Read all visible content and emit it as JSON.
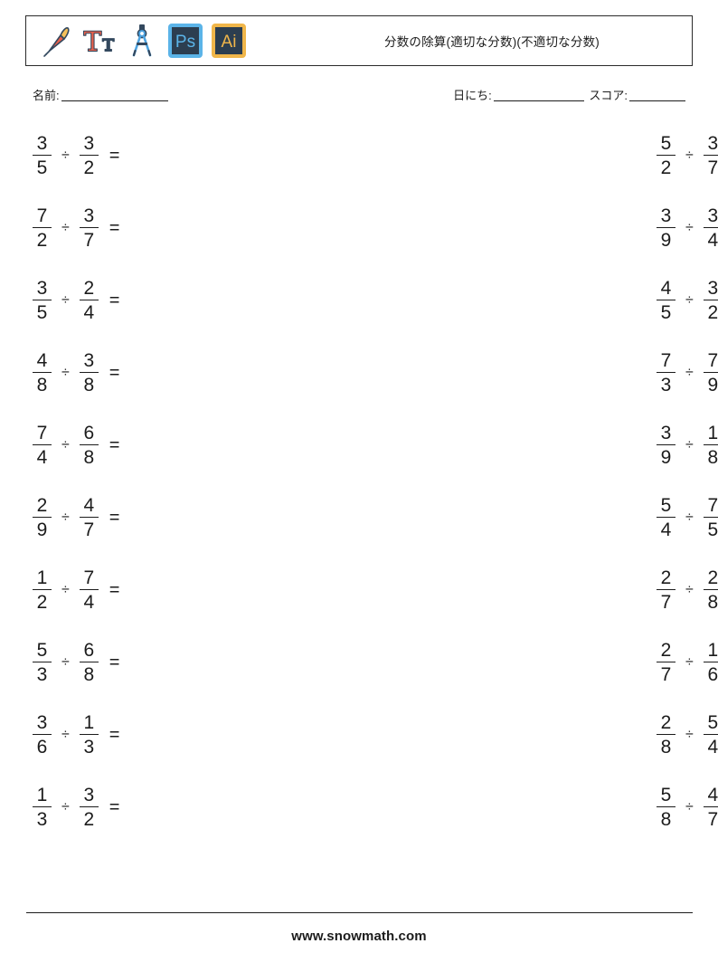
{
  "header": {
    "title": "分数の除算(適切な分数)(不適切な分数)",
    "icons": [
      {
        "name": "paintbrush-icon",
        "label": "paintbrush"
      },
      {
        "name": "typography-icon",
        "label": "TT"
      },
      {
        "name": "compass-icon",
        "label": "compass"
      },
      {
        "name": "photoshop-icon",
        "label": "Ps"
      },
      {
        "name": "illustrator-icon",
        "label": "Ai"
      }
    ]
  },
  "meta": {
    "name_label": "名前:",
    "date_label": "日にち:",
    "score_label": "スコア:"
  },
  "problems": {
    "operator": "÷",
    "equals": "=",
    "rows": [
      {
        "left": {
          "n1": "3",
          "d1": "5",
          "n2": "3",
          "d2": "2"
        },
        "right": {
          "n1": "5",
          "d1": "2",
          "n2": "3",
          "d2": "7"
        }
      },
      {
        "left": {
          "n1": "7",
          "d1": "2",
          "n2": "3",
          "d2": "7"
        },
        "right": {
          "n1": "3",
          "d1": "9",
          "n2": "3",
          "d2": "4"
        }
      },
      {
        "left": {
          "n1": "3",
          "d1": "5",
          "n2": "2",
          "d2": "4"
        },
        "right": {
          "n1": "4",
          "d1": "5",
          "n2": "3",
          "d2": "2"
        }
      },
      {
        "left": {
          "n1": "4",
          "d1": "8",
          "n2": "3",
          "d2": "8"
        },
        "right": {
          "n1": "7",
          "d1": "3",
          "n2": "7",
          "d2": "9"
        }
      },
      {
        "left": {
          "n1": "7",
          "d1": "4",
          "n2": "6",
          "d2": "8"
        },
        "right": {
          "n1": "3",
          "d1": "9",
          "n2": "1",
          "d2": "8"
        }
      },
      {
        "left": {
          "n1": "2",
          "d1": "9",
          "n2": "4",
          "d2": "7"
        },
        "right": {
          "n1": "5",
          "d1": "4",
          "n2": "7",
          "d2": "5"
        }
      },
      {
        "left": {
          "n1": "1",
          "d1": "2",
          "n2": "7",
          "d2": "4"
        },
        "right": {
          "n1": "2",
          "d1": "7",
          "n2": "2",
          "d2": "8"
        }
      },
      {
        "left": {
          "n1": "5",
          "d1": "3",
          "n2": "6",
          "d2": "8"
        },
        "right": {
          "n1": "2",
          "d1": "7",
          "n2": "1",
          "d2": "6"
        }
      },
      {
        "left": {
          "n1": "3",
          "d1": "6",
          "n2": "1",
          "d2": "3"
        },
        "right": {
          "n1": "2",
          "d1": "8",
          "n2": "5",
          "d2": "4"
        }
      },
      {
        "left": {
          "n1": "1",
          "d1": "3",
          "n2": "3",
          "d2": "2"
        },
        "right": {
          "n1": "5",
          "d1": "8",
          "n2": "4",
          "d2": "7"
        }
      }
    ]
  },
  "footer": {
    "site": "www.snowmath.com"
  },
  "colors": {
    "ink": "#1c1c1c",
    "brush_handle": "#e8604c",
    "brush_tip": "#f5c05a",
    "type_red": "#e8604c",
    "type_navy": "#33485e",
    "compass_blue": "#4da3e0",
    "ps_border": "#5bb4e8",
    "ps_fill": "#2c3e50",
    "ai_border": "#f0b64a",
    "ai_fill": "#2c3e50"
  }
}
